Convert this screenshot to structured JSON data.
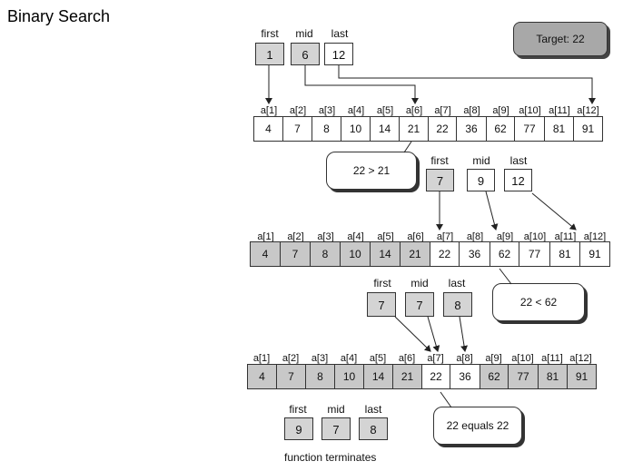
{
  "title": "Binary Search",
  "target_label": "Target: 22",
  "pointer_labels": {
    "first": "first",
    "mid": "mid",
    "last": "last"
  },
  "index_labels": [
    "a[1]",
    "a[2]",
    "a[3]",
    "a[4]",
    "a[5]",
    "a[6]",
    "a[7]",
    "a[8]",
    "a[9]",
    "a[10]",
    "a[11]",
    "a[12]"
  ],
  "array_values": [
    "4",
    "7",
    "8",
    "10",
    "14",
    "21",
    "22",
    "36",
    "62",
    "77",
    "81",
    "91"
  ],
  "steps": [
    {
      "first": "1",
      "mid": "6",
      "last": "12",
      "comparison": "22 > 21",
      "active_from": 1,
      "active_to": 12
    },
    {
      "first": "7",
      "mid": "9",
      "last": "12",
      "comparison": "22 < 62",
      "active_from": 7,
      "active_to": 12
    },
    {
      "first": "7",
      "mid": "7",
      "last": "8",
      "comparison": "22 equals 22",
      "active_from": 7,
      "active_to": 8
    },
    {
      "first": "9",
      "mid": "7",
      "last": "8"
    }
  ],
  "termination": "function terminates"
}
